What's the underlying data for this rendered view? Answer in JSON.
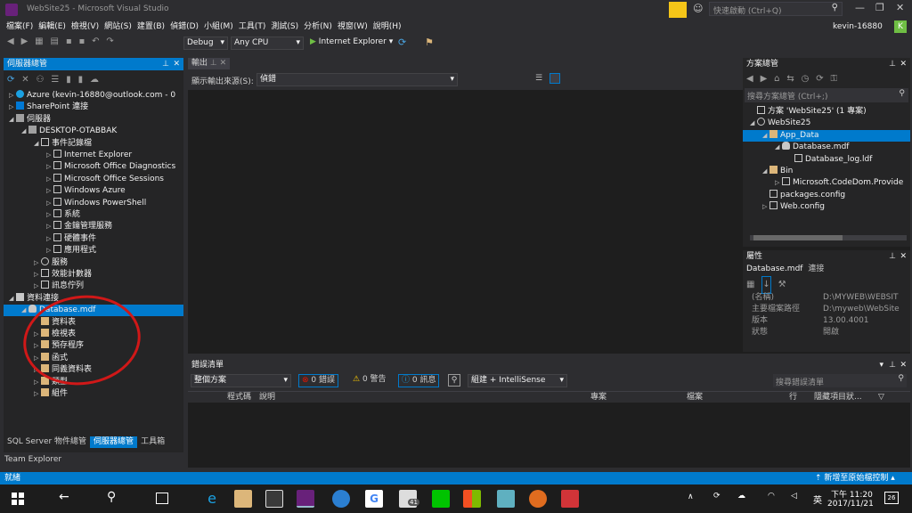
{
  "window": {
    "title": "WebSite25 - Microsoft Visual Studio",
    "quick_launch_placeholder": "快速啟動 (Ctrl+Q)",
    "user": "kevin-16880",
    "avatar_letter": "K"
  },
  "menu": [
    "檔案(F)",
    "編輯(E)",
    "檢視(V)",
    "網站(S)",
    "建置(B)",
    "偵錯(D)",
    "小組(M)",
    "工具(T)",
    "測試(S)",
    "分析(N)",
    "視窗(W)",
    "說明(H)"
  ],
  "toolbar": {
    "config": "Debug",
    "platform": "Any CPU",
    "run_label": "Internet Explorer"
  },
  "server_explorer": {
    "title": "伺服器總管",
    "items": [
      {
        "label": "Azure (kevin-16880@outlook.com - 0",
        "indent": 0,
        "arrow": "▷",
        "icon": "cloud"
      },
      {
        "label": "SharePoint 連接",
        "indent": 0,
        "arrow": "▷",
        "icon": "sp"
      },
      {
        "label": "伺服器",
        "indent": 0,
        "arrow": "◢",
        "icon": "server"
      },
      {
        "label": "DESKTOP-OTABBAK",
        "indent": 1,
        "arrow": "◢",
        "icon": "server"
      },
      {
        "label": "事件記錄檔",
        "indent": 2,
        "arrow": "◢",
        "icon": "event"
      },
      {
        "label": "Internet Explorer",
        "indent": 3,
        "arrow": "▷",
        "icon": "event"
      },
      {
        "label": "Microsoft Office Diagnostics",
        "indent": 3,
        "arrow": "▷",
        "icon": "event"
      },
      {
        "label": "Microsoft Office Sessions",
        "indent": 3,
        "arrow": "▷",
        "icon": "event"
      },
      {
        "label": "Windows Azure",
        "indent": 3,
        "arrow": "▷",
        "icon": "event"
      },
      {
        "label": "Windows PowerShell",
        "indent": 3,
        "arrow": "▷",
        "icon": "event"
      },
      {
        "label": "系統",
        "indent": 3,
        "arrow": "▷",
        "icon": "event"
      },
      {
        "label": "金鑰管理服務",
        "indent": 3,
        "arrow": "▷",
        "icon": "event"
      },
      {
        "label": "硬體事件",
        "indent": 3,
        "arrow": "▷",
        "icon": "event"
      },
      {
        "label": "應用程式",
        "indent": 3,
        "arrow": "▷",
        "icon": "event"
      },
      {
        "label": "服務",
        "indent": 2,
        "arrow": "▷",
        "icon": "gear"
      },
      {
        "label": "效能計數器",
        "indent": 2,
        "arrow": "▷",
        "icon": "perf"
      },
      {
        "label": "訊息佇列",
        "indent": 2,
        "arrow": "▷",
        "icon": "msg"
      },
      {
        "label": "資料連接",
        "indent": 0,
        "arrow": "◢",
        "icon": "data"
      },
      {
        "label": "Database.mdf",
        "indent": 1,
        "arrow": "◢",
        "icon": "db",
        "selected": true
      },
      {
        "label": "資料表",
        "indent": 2,
        "arrow": "",
        "icon": "folder"
      },
      {
        "label": "檢視表",
        "indent": 2,
        "arrow": "▷",
        "icon": "folder"
      },
      {
        "label": "預存程序",
        "indent": 2,
        "arrow": "▷",
        "icon": "folder"
      },
      {
        "label": "函式",
        "indent": 2,
        "arrow": "▷",
        "icon": "folder"
      },
      {
        "label": "同義資料表",
        "indent": 2,
        "arrow": "▷",
        "icon": "folder"
      },
      {
        "label": "類型",
        "indent": 2,
        "arrow": "▷",
        "icon": "folder"
      },
      {
        "label": "組件",
        "indent": 2,
        "arrow": "▷",
        "icon": "folder"
      }
    ],
    "bottom_tabs": [
      "SQL Server 物件總管",
      "伺服器總管",
      "工具箱"
    ],
    "team_explorer": "Team Explorer"
  },
  "output": {
    "tab": "輸出",
    "source_label": "顯示輸出來源(S):",
    "source_value": "偵錯"
  },
  "solution_explorer": {
    "title": "方案總管",
    "search_placeholder": "搜尋方案總管 (Ctrl+;)",
    "items": [
      {
        "label": "方案 'WebSite25' (1 專案)",
        "indent": 0,
        "arrow": "",
        "icon": "sln"
      },
      {
        "label": "WebSite25",
        "indent": 0,
        "arrow": "◢",
        "icon": "globe"
      },
      {
        "label": "App_Data",
        "indent": 1,
        "arrow": "◢",
        "icon": "folder",
        "selected": true
      },
      {
        "label": "Database.mdf",
        "indent": 2,
        "arrow": "◢",
        "icon": "db"
      },
      {
        "label": "Database_log.ldf",
        "indent": 3,
        "arrow": "",
        "icon": "file"
      },
      {
        "label": "Bin",
        "indent": 1,
        "arrow": "◢",
        "icon": "folder"
      },
      {
        "label": "Microsoft.CodeDom.Provide",
        "indent": 2,
        "arrow": "▷",
        "icon": "file"
      },
      {
        "label": "packages.config",
        "indent": 1,
        "arrow": "",
        "icon": "file"
      },
      {
        "label": "Web.config",
        "indent": 1,
        "arrow": "▷",
        "icon": "file"
      }
    ]
  },
  "properties": {
    "title": "屬性",
    "object": "Database.mdf",
    "object_type": "連接",
    "rows": [
      {
        "key": "(名稱)",
        "value": "D:\\MYWEB\\WEBSIT"
      },
      {
        "key": "主要檔案路徑",
        "value": "D:\\myweb\\WebSite"
      },
      {
        "key": "版本",
        "value": "13.00.4001"
      },
      {
        "key": "狀態",
        "value": "開啟"
      }
    ]
  },
  "error_list": {
    "title": "錯誤清單",
    "scope": "整個方案",
    "errors": "0 錯誤",
    "warnings": "0 警告",
    "messages": "0 訊息",
    "build_filter": "組建 + IntelliSense",
    "search_placeholder": "搜尋錯誤清單",
    "columns": [
      "程式碼",
      "說明",
      "專案",
      "檔案",
      "行",
      "隱藏項目狀..."
    ]
  },
  "status": {
    "left": "就緒",
    "right": "新增至原始檔控制"
  },
  "taskbar": {
    "time": "下午 11:20",
    "date": "2017/11/21",
    "ime": "英",
    "badge": "41",
    "notif": "26"
  },
  "colors": {
    "accent": "#007acc",
    "vs_purple": "#68217a",
    "selection": "#007acc"
  }
}
